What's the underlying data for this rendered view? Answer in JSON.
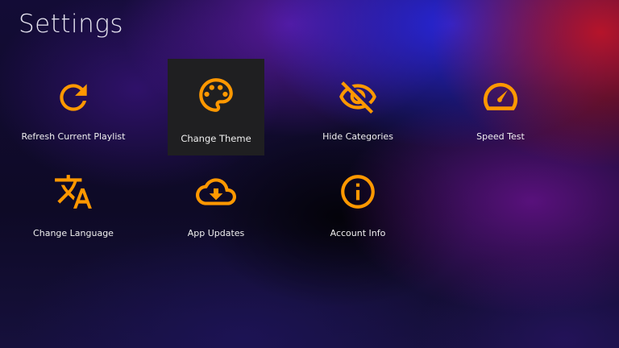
{
  "page": {
    "title": "Settings"
  },
  "theme": {
    "accent": "#ff9800",
    "focus_bg": "#1f1f21"
  },
  "settings": [
    {
      "label": "Refresh Current Playlist",
      "icon": "refresh-icon"
    },
    {
      "label": "Change Theme",
      "icon": "palette-icon",
      "focused": true
    },
    {
      "label": "Hide Categories",
      "icon": "eye-off-icon"
    },
    {
      "label": "Speed Test",
      "icon": "speedometer-icon"
    },
    {
      "label": "Change Language",
      "icon": "translate-icon"
    },
    {
      "label": "App Updates",
      "icon": "cloud-download-icon"
    },
    {
      "label": "Account Info",
      "icon": "info-icon"
    }
  ]
}
